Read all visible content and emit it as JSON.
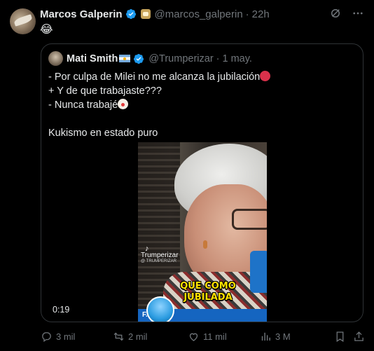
{
  "post": {
    "author_name": "Marcos Galperin",
    "handle": "@marcos_galperin",
    "separator": "·",
    "time": "22h",
    "body_emoji": "😂"
  },
  "quoted": {
    "author_name": "Mati Smith",
    "handle": "@Trumperizar",
    "separator": "·",
    "time": "1 may.",
    "line1": "- Por culpa de Milei no me alcanza la jubilación",
    "line2": "+ Y de que trabajaste???",
    "line3": "- Nunca trabajé",
    "line4": "Kukismo en estado puro"
  },
  "video": {
    "watermark": "Trumperizar",
    "watermark_sub": "@ TRUMPERIZAR",
    "caption_line1": "QUE COMO",
    "caption_line2": "JUBILADA",
    "banner": "F...O\"",
    "duration": "0:19"
  },
  "actions": {
    "replies": "3 mil",
    "reposts": "2 mil",
    "likes": "11 mil",
    "views": "3 M"
  },
  "colors": {
    "background": "#000000",
    "text": "#e7e9ea",
    "muted": "#71767b",
    "border": "#2f3336",
    "verified": "#1d9bf0",
    "caption": "#ffe100"
  },
  "icons": [
    "verified-icon",
    "grok-icon",
    "more-icon",
    "reply-icon",
    "repost-icon",
    "like-icon",
    "views-icon",
    "bookmark-icon",
    "share-icon"
  ]
}
